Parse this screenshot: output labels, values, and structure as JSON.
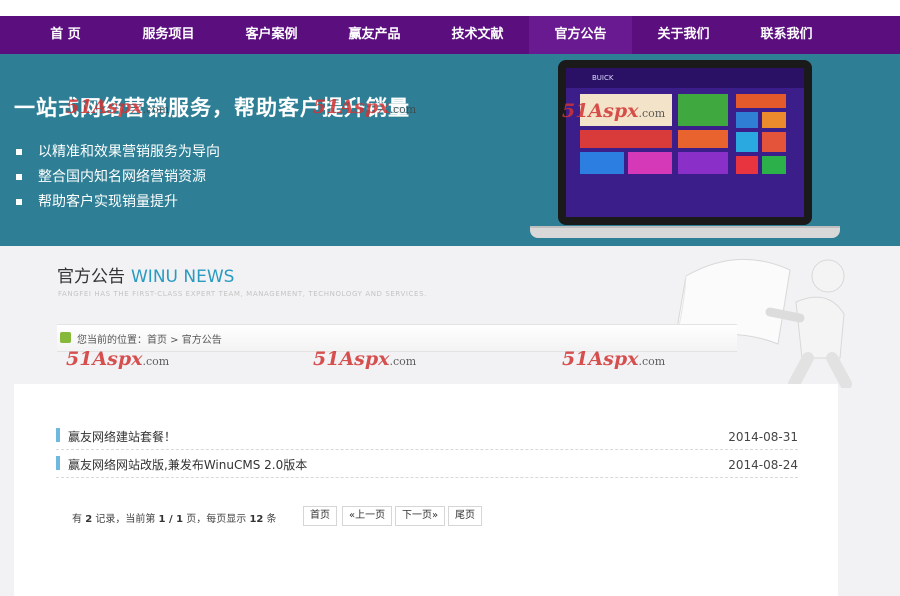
{
  "nav": {
    "items": [
      "首 页",
      "服务项目",
      "客户案例",
      "赢友产品",
      "技术文献",
      "官方公告",
      "关于我们",
      "联系我们"
    ],
    "active_index": 5
  },
  "banner": {
    "title": "一站式网络营销服务，帮助客户提升销量",
    "bullets": [
      "以精准和效果营销服务为导向",
      "整合国内知名网络营销资源",
      "帮助客户实现销量提升"
    ],
    "screen_brand": "BUICK",
    "screen_phone": "TEL:0755-8334-8888",
    "screen_ad_text": "WINUCMS"
  },
  "watermark": {
    "main": "51Aspx",
    "suffix": ".com"
  },
  "section": {
    "title_cn": "官方公告",
    "title_en": "WINU NEWS",
    "subtitle": "FANGFEI HAS THE FIRST-CLASS EXPERT TEAM, MANAGEMENT, TECHNOLOGY AND SERVICES."
  },
  "breadcrumb": {
    "text": "您当前的位置：首页 > 官方公告"
  },
  "news": [
    {
      "title": "赢友网络建站套餐！",
      "date": "2014-08-31"
    },
    {
      "title": "赢友网络网站改版,兼发布WinuCMS 2.0版本",
      "date": "2014-08-24"
    }
  ],
  "pager": {
    "total_label": "有",
    "total": "2",
    "records_label": "记录，当前第",
    "current": "1 / 1",
    "page_label": "页，每页显示",
    "per_page": "12",
    "unit": "条",
    "first": "首页",
    "prev": "«上一页",
    "next": "下一页»",
    "last": "尾页"
  },
  "colors": {
    "nav_bg": "#5b0f7f",
    "banner_bg": "#2e7f95",
    "accent_blue": "#2a9bc0",
    "list_mark": "#6fb8de"
  }
}
